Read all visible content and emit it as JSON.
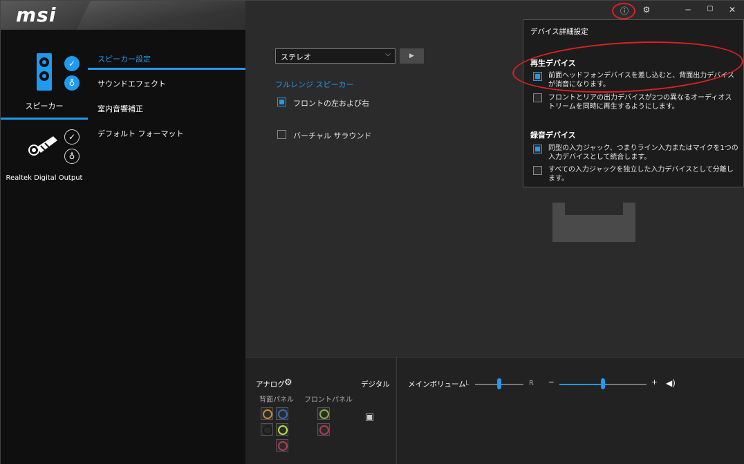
{
  "brand": {
    "logo": "msi"
  },
  "colors": {
    "accent": "#1e9bf0",
    "highlight": "#e02020",
    "bg": "#2b2b2b",
    "panel": "#0f0f0f"
  },
  "devices": [
    {
      "label": "スピーカー",
      "icon": "speaker-icon",
      "active": true
    },
    {
      "label": "Realtek Digital Output",
      "icon": "digital-plug-icon",
      "active": false
    }
  ],
  "menu": {
    "items": [
      {
        "label": "スピーカー設定"
      },
      {
        "label": "サウンドエフェクト"
      },
      {
        "label": "室内音響補正"
      },
      {
        "label": "デフォルト フォーマット"
      }
    ]
  },
  "titlebar": {
    "icons": [
      "info-icon",
      "gear-icon",
      "minimize-icon",
      "maximize-icon",
      "close-icon"
    ],
    "info_glyph": "ⓘ",
    "gear_glyph": "⚙",
    "min_glyph": "−",
    "max_glyph": "▢",
    "close_glyph": "✕"
  },
  "speaker_config": {
    "selected": "ステレオ",
    "chevron": "⌵",
    "play_glyph": "▶",
    "fullrange_label": "フルレンジ スピーカー",
    "front_lr": {
      "label": "フロントの左および右",
      "checked": true
    },
    "virtual_surround": {
      "label": "バーチャル サラウンド",
      "checked": false
    }
  },
  "popup": {
    "title": "デバイス詳細設定",
    "playback": {
      "heading": "再生デバイス",
      "options": [
        {
          "text": "前面ヘッドフォンデバイスを差し込むと、背面出力デバイスが消音になります。",
          "checked": true
        },
        {
          "text": "フロントとリアの出力デバイスが2つの異なるオーディオストリームを同時に再生するようにします。",
          "checked": false
        }
      ]
    },
    "recording": {
      "heading": "録音デバイス",
      "options": [
        {
          "text": "同型の入力ジャック、つまりライン入力またはマイクを1つの入力デバイスとして統合します。",
          "checked": true
        },
        {
          "text": "すべての入力ジャックを独立した入力デバイスとして分離します。",
          "checked": false
        }
      ]
    }
  },
  "bottom": {
    "analog_label": "アナログ",
    "rear_label": "背面パネル",
    "front_label": "フロントパネル",
    "digital_label": "デジタル",
    "main_volume_label": "メインボリューム",
    "balance_left": "L",
    "balance_right": "R",
    "vol_minus": "−",
    "vol_plus": "+",
    "volume_level": 0.5,
    "balance_level": 0.5,
    "rear_jacks": [
      "#c8883a",
      "#2d6db5",
      "#1a1a1a",
      "#b8e04a",
      "#b03a5a"
    ],
    "front_jacks": [
      "#8ab04a",
      "#b03a5a"
    ]
  }
}
